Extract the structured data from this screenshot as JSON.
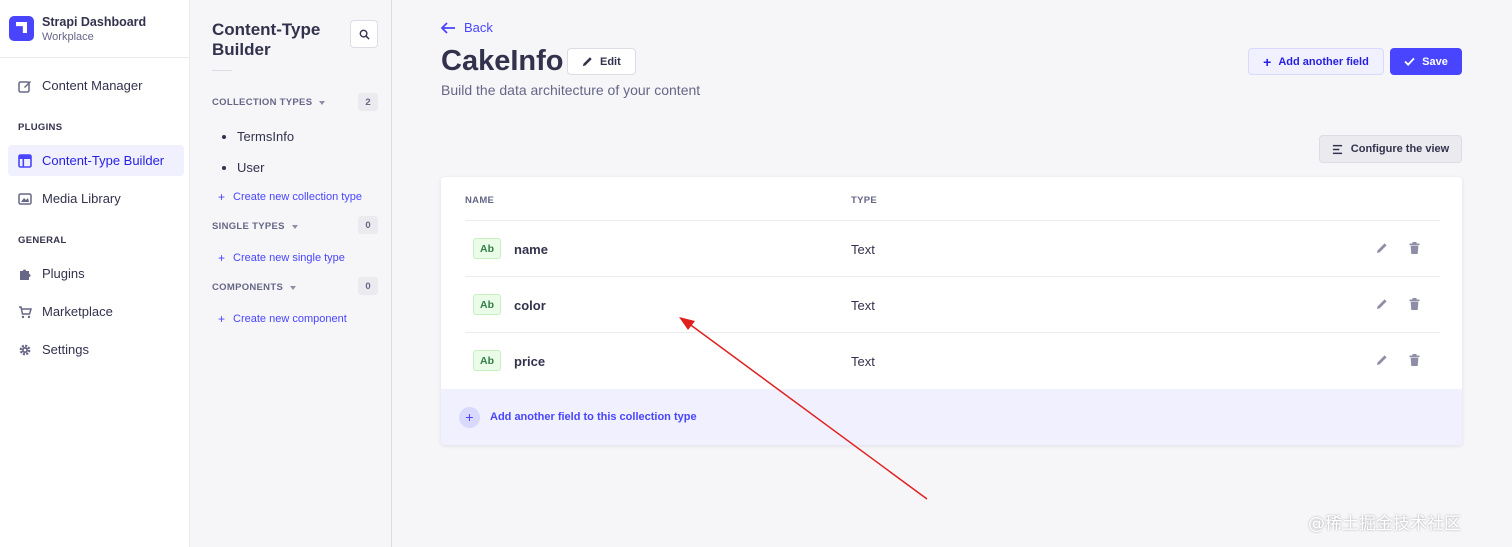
{
  "brand": {
    "title": "Strapi Dashboard",
    "subtitle": "Workplace"
  },
  "nav": {
    "content_manager": "Content Manager",
    "plugins_section": "PLUGINS",
    "content_type_builder": "Content-Type Builder",
    "media_library": "Media Library",
    "general_section": "GENERAL",
    "plugins": "Plugins",
    "marketplace": "Marketplace",
    "settings": "Settings"
  },
  "subnav": {
    "title": "Content-Type Builder",
    "collection_types": {
      "label": "COLLECTION TYPES",
      "count": "2",
      "items": [
        "TermsInfo",
        "User"
      ],
      "create": "Create new collection type"
    },
    "single_types": {
      "label": "SINGLE TYPES",
      "count": "0",
      "create": "Create new single type"
    },
    "components": {
      "label": "COMPONENTS",
      "count": "0",
      "create": "Create new component"
    }
  },
  "header": {
    "back": "Back",
    "title": "CakeInfo",
    "edit": "Edit",
    "subtitle": "Build the data architecture of your content",
    "add_field": "Add another field",
    "save": "Save",
    "configure": "Configure the view"
  },
  "table": {
    "columns": {
      "name": "NAME",
      "type": "TYPE"
    },
    "rows": [
      {
        "badge": "Ab",
        "name": "name",
        "type": "Text"
      },
      {
        "badge": "Ab",
        "name": "color",
        "type": "Text"
      },
      {
        "badge": "Ab",
        "name": "price",
        "type": "Text"
      }
    ],
    "footer_add": "Add another field to this collection type"
  },
  "watermark": "@稀土掘金技术社区",
  "colors": {
    "primary": "#4945ff",
    "primary_light": "#f0f0ff",
    "annotation_arrow": "#e0201e"
  }
}
